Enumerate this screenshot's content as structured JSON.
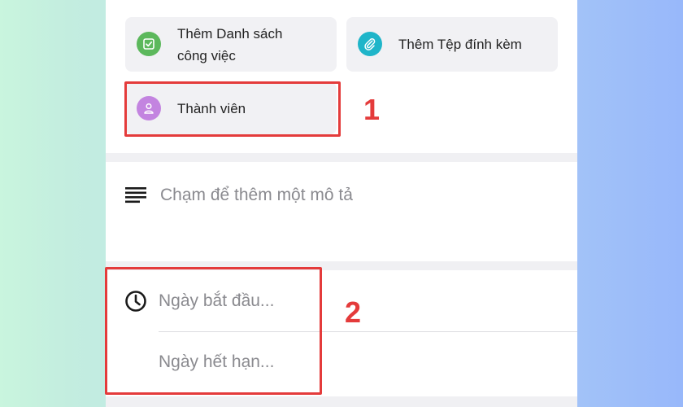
{
  "actions": {
    "checklist": {
      "line1": "Thêm Danh sách",
      "line2": "công việc",
      "icon": "checklist-icon",
      "color": "#5cb85c"
    },
    "attachment": {
      "label": "Thêm Tệp đính kèm",
      "icon": "paperclip-icon",
      "color": "#1fb5c9"
    },
    "members": {
      "label": "Thành viên",
      "icon": "person-icon",
      "color": "#c384e0"
    }
  },
  "description": {
    "placeholder": "Chạm để thêm một mô tả",
    "icon": "text-lines-icon"
  },
  "dates": {
    "icon": "clock-icon",
    "start_placeholder": "Ngày bắt đầu...",
    "due_placeholder": "Ngày hết hạn..."
  },
  "annotations": {
    "first": "1",
    "second": "2",
    "color": "#e43b3b"
  }
}
